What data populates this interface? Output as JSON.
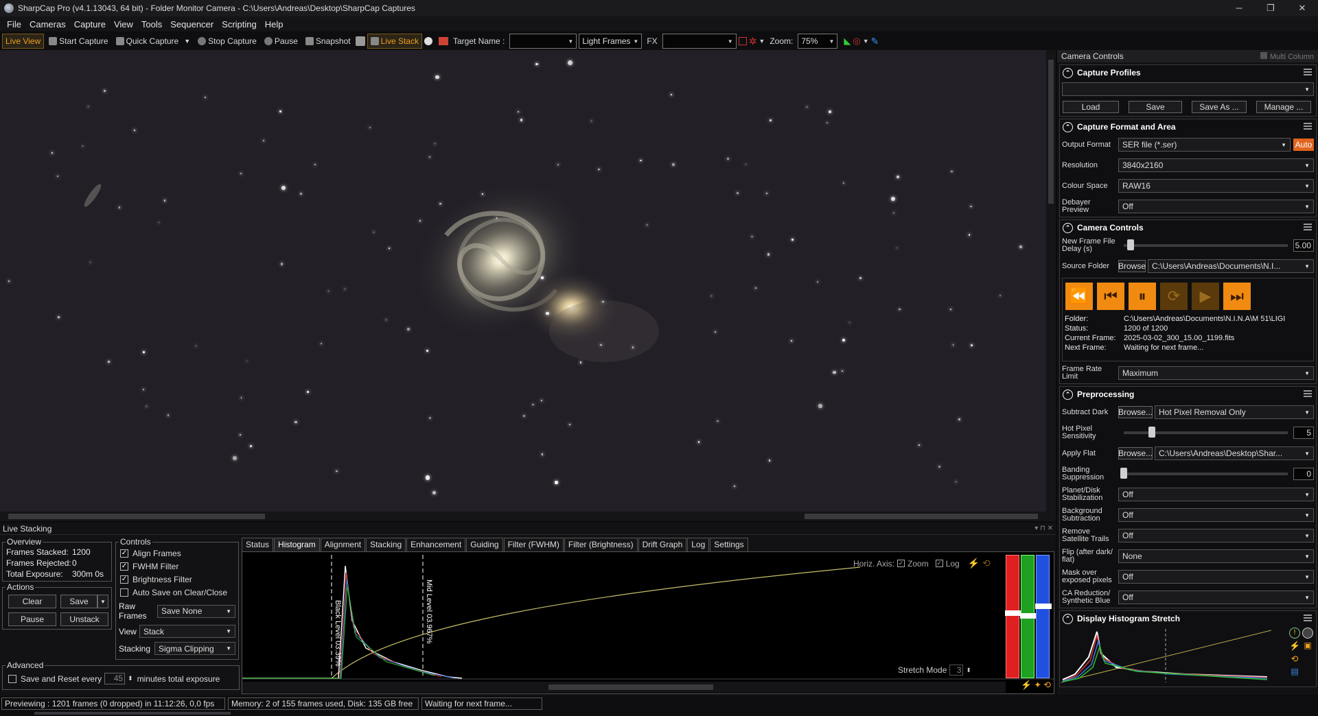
{
  "titlebar": {
    "title": "SharpCap Pro (v4.1.13043, 64 bit) - Folder Monitor Camera - C:\\Users\\Andreas\\Desktop\\SharpCap Captures",
    "min": "─",
    "max": "❐",
    "close": "✕"
  },
  "menu": [
    "File",
    "Cameras",
    "Capture",
    "View",
    "Tools",
    "Sequencer",
    "Scripting",
    "Help"
  ],
  "toolbar": {
    "live_view": "Live View",
    "start_capture": "Start Capture",
    "quick_capture": "Quick Capture",
    "stop_capture": "Stop Capture",
    "pause": "Pause",
    "snapshot": "Snapshot",
    "live_stack": "Live Stack",
    "target_name_label": "Target Name :",
    "target_name_value": "",
    "frame_type": "Light Frames",
    "fx_label": "FX",
    "fx_value": "",
    "zoom_label": "Zoom:",
    "zoom_value": "75%"
  },
  "panel": {
    "title": "Camera Controls",
    "multi_column": "Multi Column",
    "capture_profiles": {
      "title": "Capture Profiles",
      "profile_value": "",
      "load": "Load",
      "save": "Save",
      "save_as": "Save As ...",
      "manage": "Manage ..."
    },
    "format": {
      "title": "Capture Format and Area",
      "output_format_label": "Output Format",
      "output_format": "SER file (*.ser)",
      "auto": "Auto",
      "resolution_label": "Resolution",
      "resolution": "3840x2160",
      "colour_space_label": "Colour Space",
      "colour_space": "RAW16",
      "debayer_label": "Debayer Preview",
      "debayer": "Off"
    },
    "camera": {
      "title": "Camera Controls",
      "new_frame_label": "New Frame File Delay (s)",
      "new_frame_value": "5.00",
      "new_frame_level": 0.04,
      "source_folder_label": "Source Folder",
      "browse": "Browse",
      "source_folder": "C:\\Users\\Andreas\\Documents\\N.I...",
      "folder_label": "Folder:",
      "folder": "C:\\Users\\Andreas\\Documents\\N.I.N.A\\M 51\\LIGI",
      "status_label": "Status:",
      "status": "1200 of 1200",
      "current_label": "Current Frame:",
      "current": "2025-03-02_300_15.00_1199.fits",
      "next_label": "Next Frame:",
      "next": "Waiting for next frame...",
      "frame_rate_label": "Frame Rate Limit",
      "frame_rate": "Maximum"
    },
    "preprocessing": {
      "title": "Preprocessing",
      "subtract_dark_label": "Subtract Dark",
      "browse": "Browse...",
      "subtract_dark": "Hot Pixel Removal Only",
      "hot_pixel_label": "Hot Pixel Sensitivity",
      "hot_pixel_value": "5",
      "hot_pixel_level": 0.17,
      "apply_flat_label": "Apply Flat",
      "apply_flat": "C:\\Users\\Andreas\\Desktop\\Shar...",
      "banding_label": "Banding Suppression",
      "banding_value": "0",
      "banding_level": 0,
      "planet_label": "Planet/Disk Stabilization",
      "planet": "Off",
      "background_label": "Background Subtraction",
      "background": "Off",
      "satellite_label": "Remove Satellite Trails",
      "satellite": "Off",
      "flip_label": "Flip (after dark/ flat)",
      "flip": "None",
      "mask_label": "Mask over exposed pixels",
      "mask": "Off",
      "ca_label": "CA Reduction/ Synthetic Blue",
      "ca": "Off"
    },
    "stretch": {
      "title": "Display Histogram Stretch"
    }
  },
  "live_stacking": {
    "title": "Live Stacking",
    "overview": {
      "legend": "Overview",
      "frames_stacked_label": "Frames Stacked:",
      "frames_stacked": "1200",
      "frames_rejected_label": "Frames Rejected:",
      "frames_rejected": "0",
      "total_exposure_label": "Total Exposure:",
      "total_exposure": "300m 0s"
    },
    "actions": {
      "legend": "Actions",
      "clear": "Clear",
      "save": "Save",
      "pause": "Pause",
      "unstack": "Unstack"
    },
    "advanced": {
      "legend": "Advanced",
      "save_reset_label": "Save and Reset every",
      "save_reset_value": "45",
      "minutes_label": "minutes total exposure"
    },
    "controls": {
      "legend": "Controls",
      "align": "Align Frames",
      "fwhm": "FWHM Filter",
      "brightness": "Brightness Filter",
      "auto_save": "Auto Save on Clear/Close",
      "raw_frames_label": "Raw Frames",
      "raw_frames": "Save None",
      "view_label": "View",
      "view": "Stack",
      "stacking_label": "Stacking",
      "stacking": "Sigma Clipping"
    },
    "tabs": [
      "Status",
      "Histogram",
      "Alignment",
      "Stacking",
      "Enhancement",
      "Guiding",
      "Filter (FWHM)",
      "Filter (Brightness)",
      "Drift Graph",
      "Log",
      "Settings"
    ],
    "histogram": {
      "horiz_axis": "Horiz. Axis:",
      "zoom": "Zoom",
      "log": "Log",
      "black_level": "Black Level 03.39%",
      "mid_level": "Mid Level 03.967%",
      "stretch_mode": "Stretch Mode",
      "stretch_mode_value": "3"
    }
  },
  "status": {
    "preview": "Previewing : 1201 frames (0 dropped) in 11:12:26, 0,0 fps",
    "memory": "Memory: 2 of 155 frames used, Disk: 135 GB free",
    "waiting": "Waiting for next frame..."
  }
}
